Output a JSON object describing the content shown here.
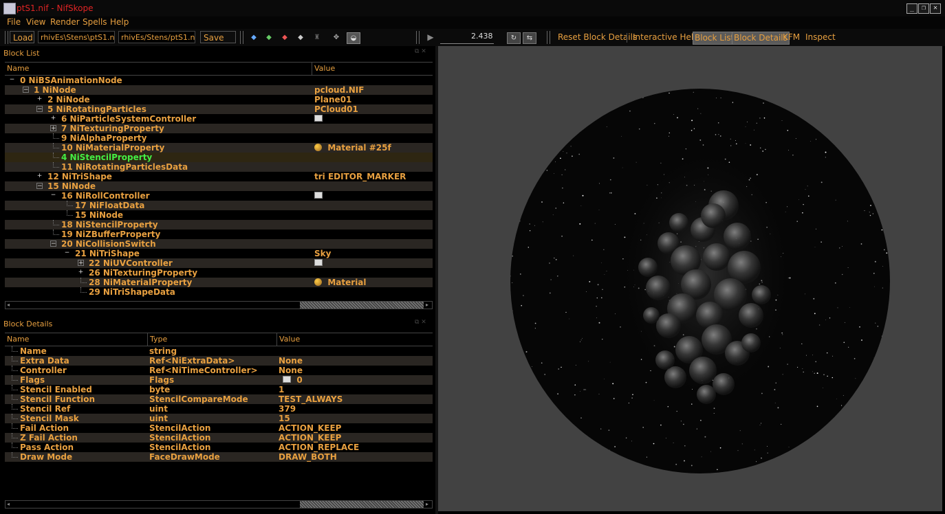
{
  "window": {
    "title": "ptS1.nif - NifSkope",
    "min_icon": "minimize-icon",
    "max_icon": "restore-icon",
    "close_icon": "close-icon"
  },
  "menu": [
    "File",
    "View",
    "Render",
    "Spells",
    "Help"
  ],
  "toolbar": {
    "load_label": "Load",
    "load_path": "rhivEs\\Stens\\ptS1.nif",
    "save_path": "rhivEs/Stens/ptS1.nif",
    "save_as_label": "Save As",
    "time_value": "2.438",
    "reset_label": "Reset Block Details",
    "help_label": "Interactive Help",
    "block_list_label": "Block List",
    "block_details_label": "Block Details",
    "kfm_label": "KFM",
    "inspect_label": "Inspect"
  },
  "block_list": {
    "title": "Block List",
    "col_name": "Name",
    "col_value": "Value",
    "rows": [
      {
        "id": "0",
        "type": "NiBSAnimationNode",
        "value": "",
        "depth": 0,
        "exp": "-",
        "color": "#e8a040"
      },
      {
        "id": "1",
        "type": "NiNode",
        "value": "pcloud.NIF",
        "depth": 1,
        "exp": "box-",
        "color": "#e8a040"
      },
      {
        "id": "2",
        "type": "NiNode",
        "value": "Plane01",
        "depth": 2,
        "exp": "+",
        "color": "#e8a040"
      },
      {
        "id": "5",
        "type": "NiRotatingParticles",
        "value": "PCloud01",
        "depth": 2,
        "exp": "box-",
        "color": "#e8a040"
      },
      {
        "id": "6",
        "type": "NiParticleSystemController",
        "value": "",
        "icon": "flag-icon",
        "depth": 3,
        "exp": "+",
        "color": "#e8a040"
      },
      {
        "id": "7",
        "type": "NiTexturingProperty",
        "value": "",
        "depth": 3,
        "exp": "box+",
        "color": "#e8a040"
      },
      {
        "id": "9",
        "type": "NiAlphaProperty",
        "value": "",
        "depth": 3,
        "exp": "",
        "color": "#e8a040"
      },
      {
        "id": "10",
        "type": "NiMaterialProperty",
        "value": "Material #25f",
        "icon": "palette-icon",
        "depth": 3,
        "exp": "",
        "color": "#e8a040"
      },
      {
        "id": "4",
        "type": "NiStencilProperty",
        "value": "",
        "depth": 3,
        "exp": "",
        "color": "#44ee44",
        "selected": true
      },
      {
        "id": "11",
        "type": "NiRotatingParticlesData",
        "value": "",
        "depth": 3,
        "exp": "",
        "color": "#e8a040"
      },
      {
        "id": "12",
        "type": "NiTriShape",
        "value": "tri EDITOR_MARKER",
        "depth": 2,
        "exp": "+",
        "color": "#e8a040"
      },
      {
        "id": "15",
        "type": "NiNode",
        "value": "",
        "depth": 2,
        "exp": "box-",
        "color": "#e8a040"
      },
      {
        "id": "16",
        "type": "NiRollController",
        "value": "",
        "icon": "flag-icon",
        "depth": 3,
        "exp": "-",
        "color": "#e8a040"
      },
      {
        "id": "17",
        "type": "NiFloatData",
        "value": "",
        "depth": 4,
        "exp": "",
        "color": "#e8a040"
      },
      {
        "id": "15",
        "type": "NiNode",
        "value": "",
        "depth": 4,
        "exp": "",
        "color": "#e8a040"
      },
      {
        "id": "18",
        "type": "NiStencilProperty",
        "value": "",
        "depth": 3,
        "exp": "",
        "color": "#e8a040"
      },
      {
        "id": "19",
        "type": "NiZBufferProperty",
        "value": "",
        "depth": 3,
        "exp": "",
        "color": "#e8a040"
      },
      {
        "id": "20",
        "type": "NiCollisionSwitch",
        "value": "",
        "depth": 3,
        "exp": "box-",
        "color": "#e8a040"
      },
      {
        "id": "21",
        "type": "NiTriShape",
        "value": "Sky",
        "depth": 4,
        "exp": "-",
        "color": "#e8a040"
      },
      {
        "id": "22",
        "type": "NiUVController",
        "value": "",
        "icon": "flag-icon",
        "depth": 5,
        "exp": "box+",
        "color": "#e8a040"
      },
      {
        "id": "26",
        "type": "NiTexturingProperty",
        "value": "",
        "depth": 5,
        "exp": "+",
        "color": "#e8a040"
      },
      {
        "id": "28",
        "type": "NiMaterialProperty",
        "value": "Material",
        "icon": "palette-icon",
        "depth": 5,
        "exp": "",
        "color": "#e8a040"
      },
      {
        "id": "29",
        "type": "NiTriShapeData",
        "value": "",
        "depth": 5,
        "exp": "",
        "color": "#e8a040"
      }
    ]
  },
  "block_details": {
    "title": "Block Details",
    "col_name": "Name",
    "col_type": "Type",
    "col_value": "Value",
    "rows": [
      {
        "name": "Name",
        "type": "string",
        "value": ""
      },
      {
        "name": "Extra Data",
        "type": "Ref<NiExtraData>",
        "value": "None"
      },
      {
        "name": "Controller",
        "type": "Ref<NiTimeController>",
        "value": "None"
      },
      {
        "name": "Flags",
        "type": "Flags",
        "value": "0",
        "icon": "flag-icon"
      },
      {
        "name": "Stencil Enabled",
        "type": "byte",
        "value": "1"
      },
      {
        "name": "Stencil Function",
        "type": "StencilCompareMode",
        "value": "TEST_ALWAYS"
      },
      {
        "name": "Stencil Ref",
        "type": "uint",
        "value": "379"
      },
      {
        "name": "Stencil Mask",
        "type": "uint",
        "value": "15"
      },
      {
        "name": "Fail Action",
        "type": "StencilAction",
        "value": "ACTION_KEEP"
      },
      {
        "name": "Z Fail Action",
        "type": "StencilAction",
        "value": "ACTION_KEEP"
      },
      {
        "name": "Pass Action",
        "type": "StencilAction",
        "value": "ACTION_REPLACE"
      },
      {
        "name": "Draw Mode",
        "type": "FaceDrawMode",
        "value": "DRAW_BOTH"
      }
    ]
  },
  "colors": {
    "accent": "#e8a040",
    "selected_text": "#44ee44",
    "viewport_bg": "#424242",
    "title_text": "#e02424"
  }
}
